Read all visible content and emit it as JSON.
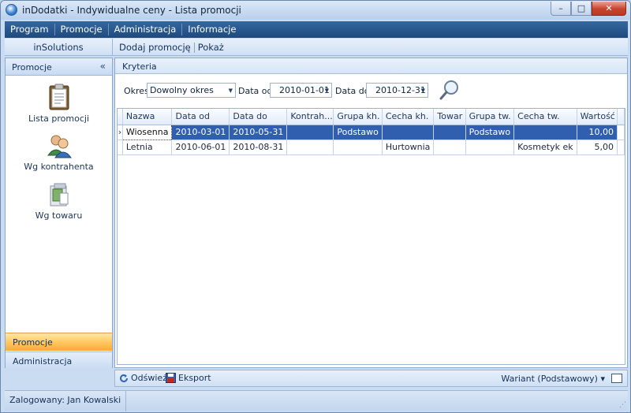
{
  "window": {
    "title": "inDodatki - Indywidualne ceny - Lista promocji",
    "minimize_glyph": "–",
    "maximize_glyph": "□",
    "close_glyph": "✕"
  },
  "menu": [
    "Program",
    "Promocje",
    "Administracja",
    "Informacje"
  ],
  "toolbar": {
    "brand": "inSolutions",
    "add_label": "Dodaj promocję",
    "show_label": "Pokaż"
  },
  "sidebar": {
    "title": "Promocje",
    "collapse_glyph": "«",
    "items": [
      {
        "label": "Lista promocji",
        "icon": "clipboard-icon"
      },
      {
        "label": "Wg kontrahenta",
        "icon": "users-icon"
      },
      {
        "label": "Wg towaru",
        "icon": "product-box-icon"
      }
    ],
    "bottom_active": "Promocje",
    "bottom_admin": "Administracja"
  },
  "criteria": {
    "header": "Kryteria",
    "okres_label": "Okres:",
    "okres_value": "Dowolny okres",
    "date_from_label": "Data od:",
    "date_from_value": "2010-01-01",
    "date_to_label": "Data do:",
    "date_to_value": "2010-12-31",
    "dropdown_glyph": "▼"
  },
  "grid": {
    "columns": [
      "Nazwa",
      "Data od",
      "Data do",
      "Kontrah...",
      "Grupa kh.",
      "Cecha kh.",
      "Towar",
      "Grupa tw.",
      "Cecha tw.",
      "Wartość"
    ],
    "row_indicator": "›",
    "rows": [
      {
        "nazwa": "Wiosenna",
        "data_od": "2010-03-01",
        "data_do": "2010-05-31",
        "kontrah": "",
        "grupa_kh": "Podstawo",
        "cecha_kh": "",
        "towar": "",
        "grupa_tw": "Podstawo",
        "cecha_tw": "",
        "wartosc": "10,00"
      },
      {
        "nazwa": "Letnia",
        "data_od": "2010-06-01",
        "data_do": "2010-08-31",
        "kontrah": "",
        "grupa_kh": "",
        "cecha_kh": "Hurtownia",
        "towar": "",
        "grupa_tw": "",
        "cecha_tw": "Kosmetyk ek",
        "wartosc": "5,00"
      }
    ]
  },
  "bottom": {
    "refresh_label": "Odśwież",
    "export_label": "Eksport",
    "variant_label": "Wariant (Podstawowy) ▾"
  },
  "status": {
    "text": "Zalogowany: Jan Kowalski"
  },
  "colors": {
    "accent": "#1f4a7e",
    "selection": "#2f5fae",
    "active_tab": "#ffc960"
  }
}
